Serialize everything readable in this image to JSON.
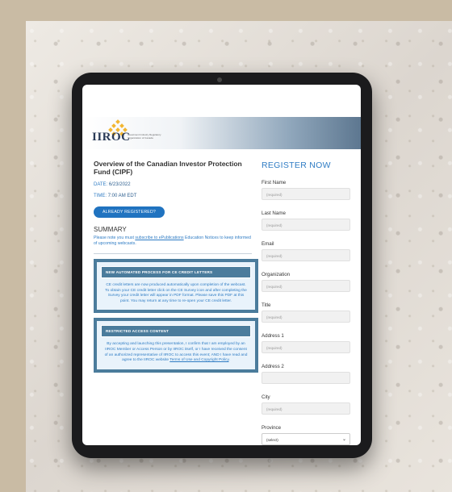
{
  "logo": {
    "text": "IIROC",
    "subtitle": "Investment Industry Regulatory Organization of Canada"
  },
  "left": {
    "title": "Overview of the Canadian Investor Protection Fund (CIPF)",
    "date_label": "DATE:",
    "date_value": "6/23/2022",
    "time_label": "TIME:",
    "time_value": "7:00 AM EDT",
    "registered_button": "ALREADY REGISTERED?",
    "summary_heading": "SUMMARY",
    "summary_pre": "Please note you must ",
    "summary_link": "subscribe to ePublications",
    "summary_post": " Education Notices to keep informed of upcoming webcasts."
  },
  "box1": {
    "heading": "NEW AUTOMATED PROCESS FOR CE CREDIT LETTERS",
    "text": "CE credit letters are now produced automatically upon completion of the webcast. To obtain your CE credit letter click on the CE Survey icon and after completing the Survey your credit letter will appear in PDF format. Please save this PDF at this point. You may return at any time to re-open your CE credit letter."
  },
  "box2": {
    "heading": "RESTRICTED ACCESS CONTENT",
    "text": "By accepting and launching this presentation, I confirm that I am employed by an IIROC Member or Access Person or by IIROC itself, or I have received the consent of an authorized representative of IIROC to access this event; AND I have read and agree to the IIROC website ",
    "link": "Terms of Use and Copyright Policy",
    "end": "."
  },
  "register": {
    "heading": "REGISTER NOW",
    "fields": [
      {
        "label": "First Name",
        "placeholder": "(required)"
      },
      {
        "label": "Last Name",
        "placeholder": "(required)"
      },
      {
        "label": "Email",
        "placeholder": "(required)"
      },
      {
        "label": "Organization",
        "placeholder": "(required)"
      },
      {
        "label": "Title",
        "placeholder": "(required)"
      },
      {
        "label": "Address 1",
        "placeholder": "(required)"
      },
      {
        "label": "Address 2",
        "placeholder": ""
      },
      {
        "label": "City",
        "placeholder": "(required)"
      }
    ],
    "province_label": "Province",
    "province_value": "(select)"
  },
  "colors": {
    "accent": "#2f7cc4",
    "button": "#2073c0",
    "box_border": "#4b7c9c",
    "logo_gold": "#f2b632"
  }
}
